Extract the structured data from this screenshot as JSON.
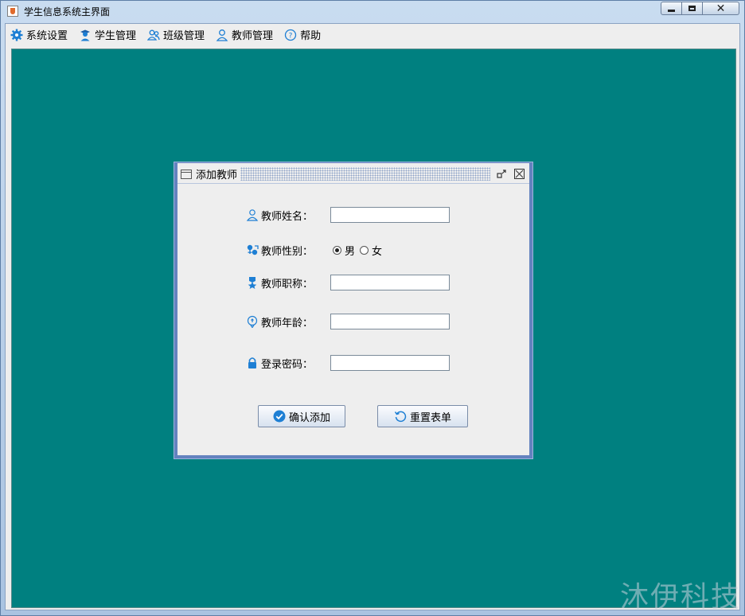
{
  "window": {
    "title": "学生信息系统主界面"
  },
  "menubar": {
    "items": [
      {
        "label": "系统设置",
        "icon": "gear-icon"
      },
      {
        "label": "学生管理",
        "icon": "student-icon"
      },
      {
        "label": "班级管理",
        "icon": "class-icon"
      },
      {
        "label": "教师管理",
        "icon": "teacher-icon"
      },
      {
        "label": "帮助",
        "icon": "help-icon"
      }
    ]
  },
  "dialog": {
    "title": "添加教师",
    "fields": {
      "name_label": "教师姓名：",
      "gender_label": "教师性别：",
      "gender_male": "男",
      "gender_female": "女",
      "gender_selected": "男",
      "title_label": "教师职称：",
      "age_label": "教师年龄：",
      "password_label": "登录密码："
    },
    "buttons": {
      "confirm": "确认添加",
      "reset": "重置表单"
    }
  },
  "watermark": "沐伊科技",
  "colors": {
    "desktop": "#008080",
    "accent": "#1e7fd4",
    "dialog_border": "#6382bf"
  }
}
